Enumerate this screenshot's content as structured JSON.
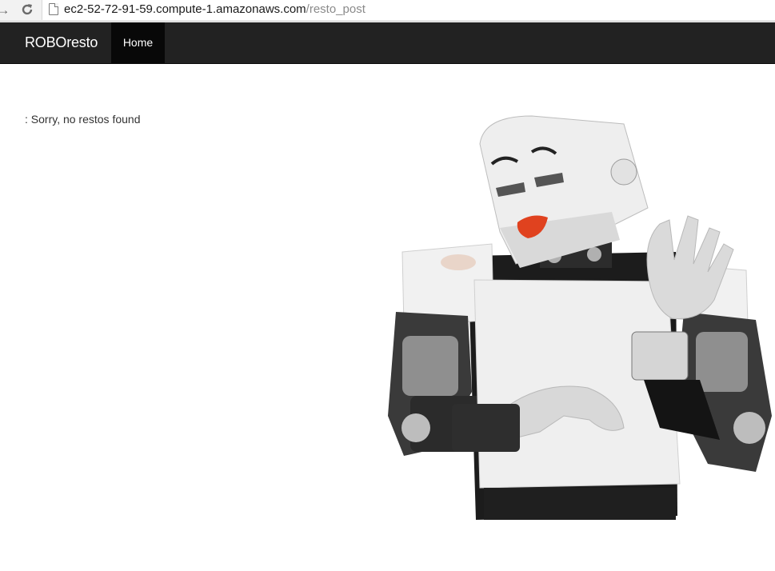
{
  "browser": {
    "url_host": "ec2-52-72-91-59.compute-1.amazonaws.com",
    "url_path": "/resto_post",
    "back_icon": "arrow-left",
    "reload_icon": "reload"
  },
  "navbar": {
    "brand": "ROBOresto",
    "items": [
      {
        "label": "Home",
        "active": true
      }
    ],
    "background": "#222222",
    "active_background": "#080808"
  },
  "main": {
    "message": ": Sorry, no restos found",
    "image_subject": "humanoid-robot-illustration"
  }
}
